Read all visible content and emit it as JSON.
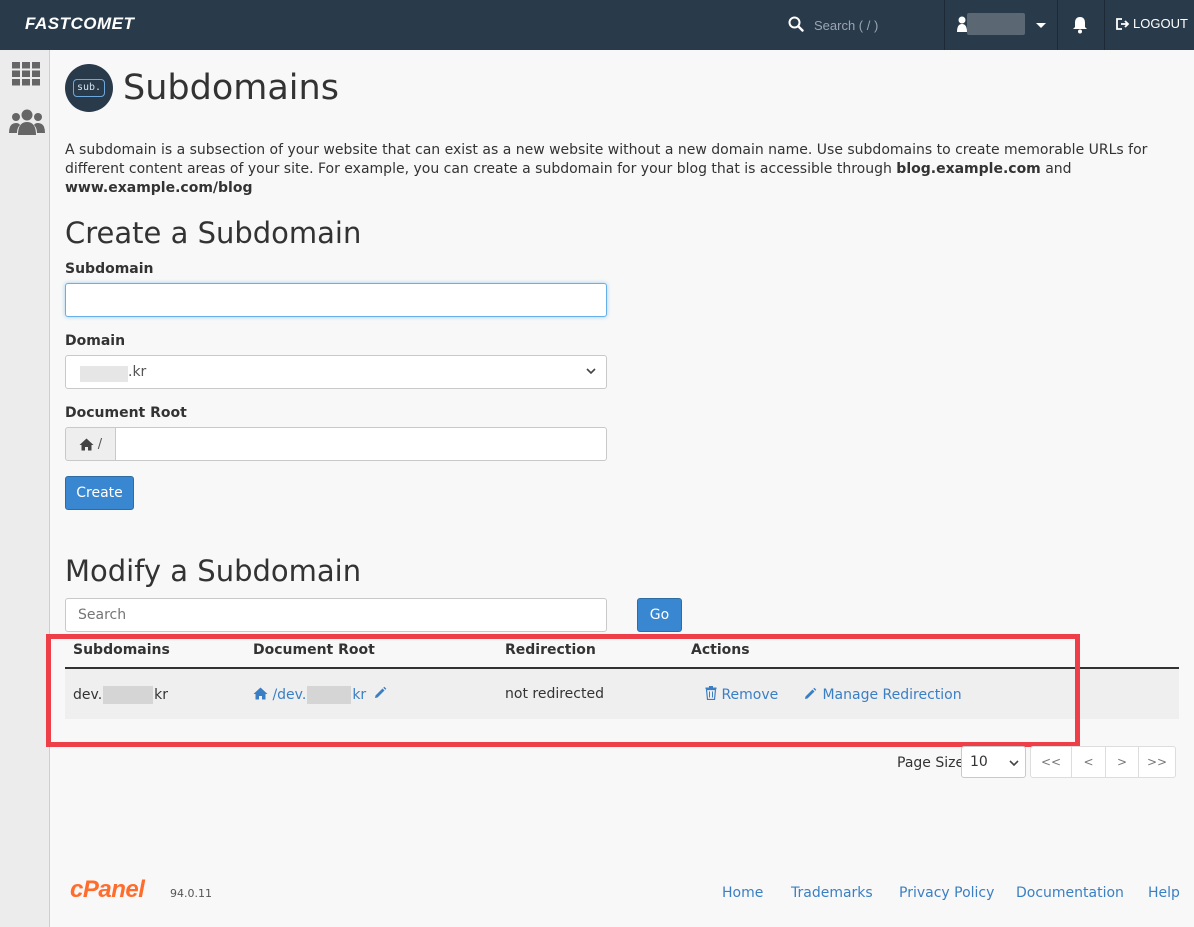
{
  "header": {
    "brand": "FASTCOMET",
    "search_placeholder": "Search ( / )",
    "logout_label": "LOGOUT"
  },
  "page": {
    "title": "Subdomains",
    "icon_text": "sub.",
    "intro_text": "A subdomain is a subsection of your website that can exist as a new website without a new domain name. Use subdomains to create memorable URLs for different content areas of your site. For example, you can create a subdomain for your blog that is accessible through ",
    "intro_bold_1": "blog.example.com",
    "intro_and": " and ",
    "intro_bold_2": "www.example.com/blog"
  },
  "create": {
    "heading": "Create a Subdomain",
    "subdomain_label": "Subdomain",
    "subdomain_value": "",
    "domain_label": "Domain",
    "domain_value_suffix": ".kr",
    "docroot_label": "Document Root",
    "docroot_prefix": "/",
    "docroot_value": "",
    "create_button": "Create"
  },
  "modify": {
    "heading": "Modify a Subdomain",
    "search_placeholder": "Search",
    "go_button": "Go",
    "columns": [
      "Subdomains",
      "Document Root",
      "Redirection",
      "Actions"
    ],
    "rows": [
      {
        "subdomain_prefix": "dev.",
        "subdomain_suffix": "kr",
        "docroot_prefix": "/dev.",
        "docroot_suffix": "kr",
        "redirection": "not redirected",
        "remove_label": "Remove",
        "manage_label": "Manage Redirection"
      }
    ]
  },
  "pagination": {
    "page_size_label": "Page Size",
    "page_size_value": "10",
    "first": "<<",
    "prev": "<",
    "next": ">",
    "last": ">>"
  },
  "footer": {
    "logo": "cPanel",
    "version": "94.0.11",
    "links": [
      "Home",
      "Trademarks",
      "Privacy Policy",
      "Documentation",
      "Help"
    ]
  },
  "colors": {
    "topbar": "#293a4a",
    "primary_button": "#3a87d1",
    "link": "#3a7fc4",
    "highlight_box": "#ee3e47",
    "cpanel_orange": "#ff6c2c"
  }
}
